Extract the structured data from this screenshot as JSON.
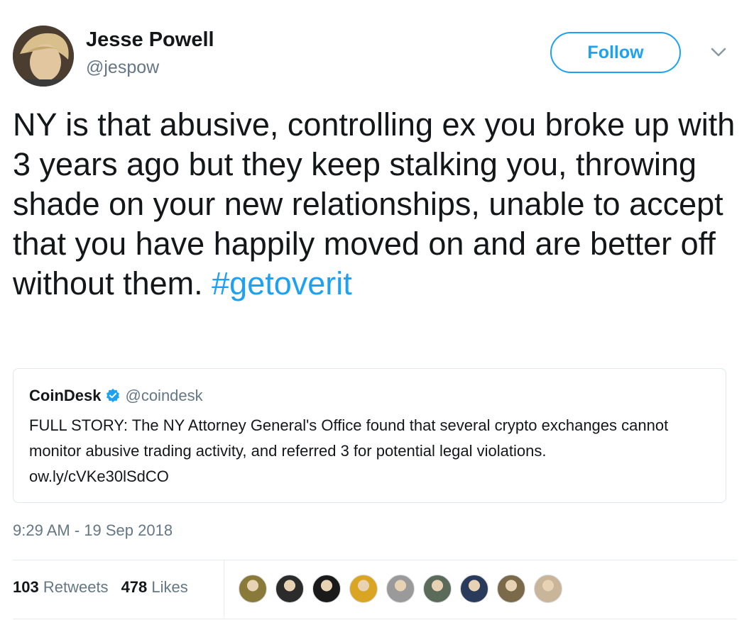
{
  "author": {
    "name": "Jesse Powell",
    "handle": "@jespow",
    "avatar_icon": "user-avatar"
  },
  "follow_button": {
    "label": "Follow",
    "color": "#1da1f2"
  },
  "menu_icon": "chevron-down-icon",
  "tweet": {
    "text": "NY is that abusive, controlling ex you broke up with 3 years ago but they keep stalking you, throwing shade on your new relationships, unable to accept that you have happily moved on and are better off without them.",
    "hashtag": "#getoverit"
  },
  "quoted_tweet": {
    "name": "CoinDesk",
    "verified_icon": "verified-badge-icon",
    "handle": "@coindesk",
    "text": "FULL STORY: The NY Attorney General's Office found that several crypto exchanges cannot monitor abusive trading activity, and referred 3 for potential legal violations.",
    "link": "ow.ly/cVKe30lSdCO"
  },
  "timestamp": "9:29 AM - 19 Sep 2018",
  "stats": {
    "retweets_count": "103",
    "retweets_label": "Retweets",
    "likes_count": "478",
    "likes_label": "Likes"
  },
  "likers": [
    {
      "icon": "liker-avatar",
      "color": "#8a7a3a"
    },
    {
      "icon": "liker-avatar",
      "color": "#2b2b2b"
    },
    {
      "icon": "liker-avatar",
      "color": "#1a1a1a"
    },
    {
      "icon": "liker-avatar",
      "color": "#d9a522"
    },
    {
      "icon": "liker-avatar",
      "color": "#9a9a9a"
    },
    {
      "icon": "liker-avatar",
      "color": "#5a6b5a"
    },
    {
      "icon": "liker-avatar",
      "color": "#2a3a5a"
    },
    {
      "icon": "liker-avatar",
      "color": "#7a6a4a"
    },
    {
      "icon": "liker-avatar",
      "color": "#c9b59a"
    }
  ]
}
